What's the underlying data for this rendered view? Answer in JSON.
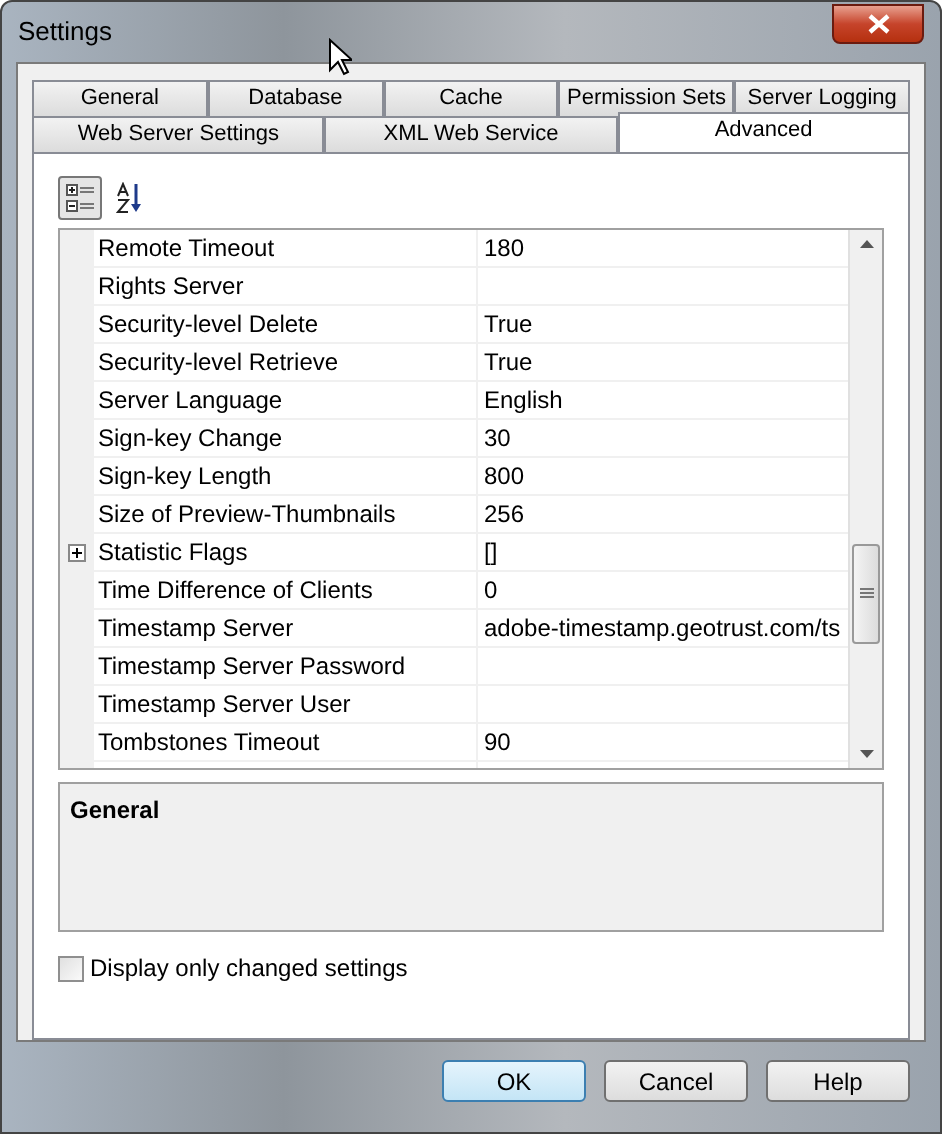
{
  "window": {
    "title": "Settings"
  },
  "tab_rows": [
    [
      {
        "label": "General",
        "selected": false
      },
      {
        "label": "Database",
        "selected": false
      },
      {
        "label": "Cache",
        "selected": false
      },
      {
        "label": "Permission Sets",
        "selected": false
      },
      {
        "label": "Server Logging",
        "selected": false
      }
    ],
    [
      {
        "label": "Web Server Settings",
        "selected": false
      },
      {
        "label": "XML Web Service",
        "selected": false
      },
      {
        "label": "Advanced",
        "selected": true
      }
    ]
  ],
  "toolbar": [
    {
      "kind": "categorized",
      "selected": true
    },
    {
      "kind": "alphabetical",
      "selected": false
    }
  ],
  "properties": [
    {
      "name": "Remote Timeout",
      "value": "180"
    },
    {
      "name": "Rights Server"
    },
    {
      "name": "Security-level Delete",
      "value": "True"
    },
    {
      "name": "Security-level Retrieve",
      "value": "True"
    },
    {
      "name": "Server Language",
      "value": "English"
    },
    {
      "name": "Sign-key Change",
      "value": "30"
    },
    {
      "name": "Sign-key Length",
      "value": "800"
    },
    {
      "name": "Size of Preview-Thumbnails",
      "value": "256"
    },
    {
      "name": "Statistic Flags",
      "value": "[]",
      "expandable": true,
      "expanded": false
    },
    {
      "name": "Time Difference of Clients",
      "value": "0"
    },
    {
      "name": "Timestamp Server",
      "value": "adobe-timestamp.geotrust.com/ts"
    },
    {
      "name": "Timestamp Server Password"
    },
    {
      "name": "Timestamp Server User"
    },
    {
      "name": "Tombstones Timeout",
      "value": "90"
    }
  ],
  "description": {
    "title": "General"
  },
  "option": {
    "label": "Display only changed settings",
    "checked": false
  },
  "buttons": [
    {
      "label": "OK",
      "default": true
    },
    {
      "label": "Cancel",
      "default": false
    },
    {
      "label": "Help",
      "default": false
    }
  ]
}
